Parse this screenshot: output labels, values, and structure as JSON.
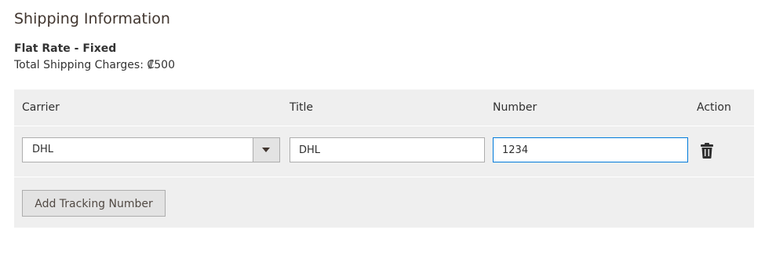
{
  "section": {
    "title": "Shipping Information",
    "method_name": "Flat Rate - Fixed",
    "charges_text": "Total Shipping Charges: ₡500"
  },
  "tracking": {
    "columns": {
      "carrier": "Carrier",
      "title": "Title",
      "number": "Number",
      "action": "Action"
    },
    "row": {
      "carrier_selected": "DHL",
      "title_value": "DHL",
      "number_value": "1234"
    },
    "add_button_label": "Add Tracking Number"
  },
  "icons": {
    "select_arrow": "chevron-down-icon",
    "delete": "trash-icon"
  },
  "colors": {
    "panel_bg": "#efefef",
    "focus_border": "#007bdb",
    "button_bg": "#e3e3e3"
  }
}
